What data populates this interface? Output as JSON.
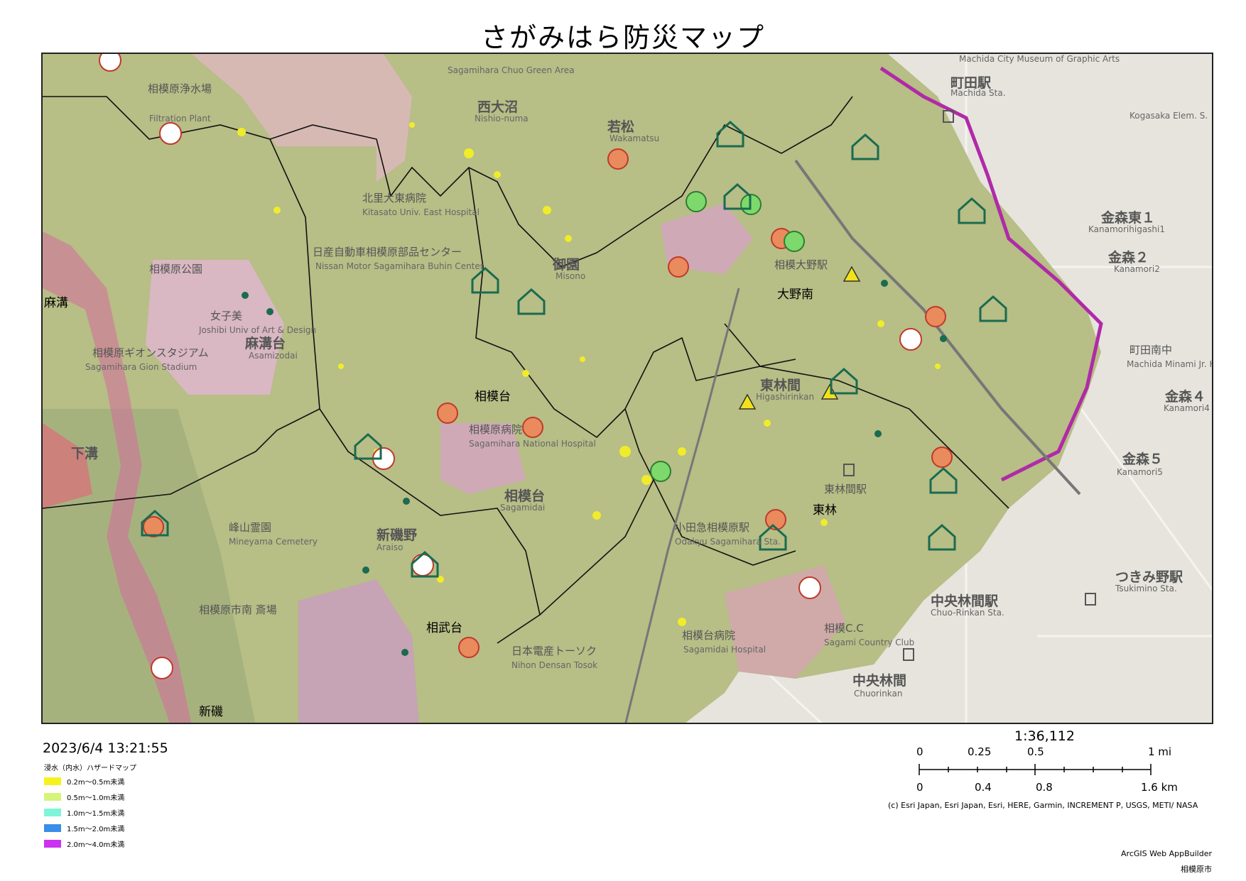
{
  "title": "さがみはら防災マップ",
  "timestamp": "2023/6/4 13:21:55",
  "legend": {
    "title": "浸水（内水）ハザードマップ",
    "items": [
      {
        "label": "0.2m～0.5m未満",
        "color": "#f5f21e"
      },
      {
        "label": "0.5m～1.0m未満",
        "color": "#d4f57a"
      },
      {
        "label": "1.0m～1.5m未満",
        "color": "#7ff5d8"
      },
      {
        "label": "1.5m～2.0m未満",
        "color": "#3a8de8"
      },
      {
        "label": "2.0m～4.0m未満",
        "color": "#cc33f0"
      }
    ]
  },
  "scale": {
    "ratio": "1:36,112",
    "mi_labels": [
      "0",
      "0.25",
      "0.5",
      "1 mi"
    ],
    "km_labels": [
      "0",
      "0.4",
      "0.8",
      "1.6 km"
    ]
  },
  "attribution": "(c) Esri Japan, Esri Japan, Esri, HERE, Garmin, INCREMENT P, USGS, METI/ NASA",
  "credits": [
    "ArcGIS Web AppBuilder",
    "相模原市"
  ],
  "map": {
    "area_labels": [
      "相模台",
      "大野南",
      "東林",
      "相武台",
      "麻溝",
      "新磯"
    ],
    "place_labels": [
      "西大沼",
      "若松",
      "御園",
      "東林間",
      "相模台",
      "新磯野",
      "下溝",
      "麻溝台",
      "町田駅",
      "金森東１",
      "金森２",
      "金森４",
      "金森５",
      "つきみ野駅",
      "中央林間駅",
      "中央林間",
      "相模大野駅",
      "東林間駅",
      "小田急相模原駅",
      "北里大東病院",
      "日産自動車相模原部品センター",
      "相模原病院",
      "相模原公園",
      "町田南中",
      "相模原市南 斎場",
      "相模C.C",
      "日本電産トーソク",
      "相模台病院",
      "相模原浄水場",
      "相模原ギオンスタジアム",
      "女子美",
      "峰山霊園"
    ],
    "en_labels": [
      "Sagamihara Chuo Green Area",
      "Nishio-numa",
      "Wakamatsu",
      "Misono",
      "Higashirinkan",
      "Sagamidai",
      "Araiso",
      "Machida Sta.",
      "Kanamorihigashi1",
      "Kanamori2",
      "Kanamori4",
      "Kanamori5",
      "Tsukimino Sta.",
      "Chuo-Rinkan Sta.",
      "Chuorinkan",
      "Sagami Country Club",
      "Nihon Densan Tosok",
      "Sagamidai Hospital",
      "Mineyama Cemetery",
      "Kitasato Univ. East Hospital",
      "Nissan Motor Sagamihara Buhin Center",
      "Sagamihara National Hospital",
      "Machida City Museum of Graphic Arts",
      "Kogasaka Elem. S.",
      "Machida Minami Jr. H. S.",
      "Filtration Plant",
      "Joshibi Univ of Art & Design",
      "Asamizodai",
      "Odakyu Sagamihara Sta.",
      "Sagamihara Gion Stadium"
    ],
    "icon_types": [
      "fire-station-icon",
      "evacuation-site-icon",
      "rescue-icon",
      "stay-shelter-icon",
      "warning-icon",
      "evacuation-route-icon"
    ]
  }
}
